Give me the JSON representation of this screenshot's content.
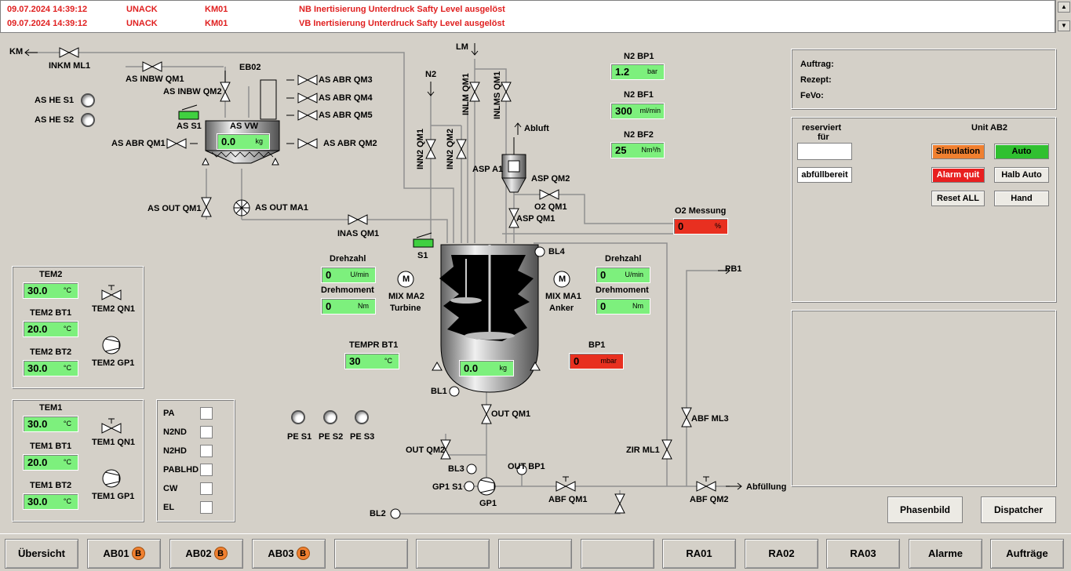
{
  "alarms": [
    {
      "time": "09.07.2024 14:39:12",
      "state": "UNACK",
      "module": "KM01",
      "text": "NB Inertisierung Unterdruck Safty Level ausgelöst"
    },
    {
      "time": "09.07.2024 14:39:12",
      "state": "UNACK",
      "module": "KM01",
      "text": "VB Inertisierung Unterdruck Safty Level ausgelöst"
    }
  ],
  "labels": {
    "km": "KM",
    "inkm_ml1": "INKM ML1",
    "as_inbw_qm1": "AS INBW QM1",
    "as_inbw_qm2": "AS INBW QM2",
    "eb02": "EB02",
    "as_abr_qm3": "AS ABR QM3",
    "as_abr_qm4": "AS ABR QM4",
    "as_abr_qm5": "AS ABR QM5",
    "as_he_s1": "AS HE S1",
    "as_he_s2": "AS HE S2",
    "as_s1": "AS S1",
    "as_vw": "AS VW",
    "as_abr_qm1": "AS ABR QM1",
    "as_abr_qm2": "AS ABR QM2",
    "as_out_qm1": "AS OUT QM1",
    "as_out_ma1": "AS OUT MA1",
    "inas_qm1": "INAS QM1",
    "lm": "LM",
    "n2": "N2",
    "inlm_qm1": "INLM QM1",
    "inlms_qm1": "INLMS QM1",
    "inn2_qm1": "INN2 QM1",
    "inn2_qm2": "INN2 QM2",
    "abluft": "Abluft",
    "asp_a1": "ASP A1",
    "asp_qm2": "ASP QM2",
    "o2_qm1": "O2 QM1",
    "asp_qm1": "ASP QM1",
    "n2_bp1": "N2 BP1",
    "n2_bf1": "N2 BF1",
    "n2_bf2": "N2 BF2",
    "o2_messung": "O2 Messung",
    "s1": "S1",
    "bl4": "BL4",
    "drehzahl_l": "Drehzahl",
    "drehmoment_l": "Drehmoment",
    "mix_ma2": "MIX MA2",
    "turbine": "Turbine",
    "drehzahl_r": "Drehzahl",
    "drehmoment_r": "Drehmoment",
    "mix_ma1": "MIX MA1",
    "anker": "Anker",
    "pb1": "PB1",
    "tempr_bt1": "TEMPR BT1",
    "bp1": "BP1",
    "bl1": "BL1",
    "out_qm1": "OUT QM1",
    "out_qm2": "OUT QM2",
    "bl3": "BL3",
    "out_bp1": "OUT BP1",
    "gp1_s1": "GP1 S1",
    "gp1": "GP1",
    "abf_qm1": "ABF QM1",
    "zir_ml1": "ZIR ML1",
    "abf_ml3": "ABF ML3",
    "abf_qm2": "ABF QM2",
    "abfuellung": "Abfüllung",
    "bl2": "BL2",
    "pe_s1": "PE S1",
    "pe_s2": "PE S2",
    "pe_s3": "PE S3",
    "m": "M"
  },
  "values": {
    "as_vw": {
      "value": "0.0",
      "unit": "kg"
    },
    "n2_bp1": {
      "value": "1.2",
      "unit": "bar"
    },
    "n2_bf1": {
      "value": "300",
      "unit": "ml/min"
    },
    "n2_bf2": {
      "value": "25",
      "unit": "Nm³/h"
    },
    "o2": {
      "value": "0",
      "unit": "%"
    },
    "drehzahl_l": {
      "value": "0",
      "unit": "U/min"
    },
    "drehmoment_l": {
      "value": "0",
      "unit": "Nm"
    },
    "drehzahl_r": {
      "value": "0",
      "unit": "U/min"
    },
    "drehmoment_r": {
      "value": "0",
      "unit": "Nm"
    },
    "tempr_bt1": {
      "value": "30",
      "unit": "°C"
    },
    "bp1": {
      "value": "0",
      "unit": "mbar"
    },
    "reactor": {
      "value": "0.0",
      "unit": "kg"
    }
  },
  "tem2": {
    "title": "TEM2",
    "value": "30.0",
    "unit": "°C",
    "bt1_label": "TEM2 BT1",
    "bt1_value": "20.0",
    "bt1_unit": "°C",
    "bt2_label": "TEM2 BT2",
    "bt2_value": "30.0",
    "bt2_unit": "°C",
    "qn1": "TEM2 QN1",
    "gp1": "TEM2 GP1"
  },
  "tem1": {
    "title": "TEM1",
    "value": "30.0",
    "unit": "°C",
    "bt1_label": "TEM1 BT1",
    "bt1_value": "20.0",
    "bt1_unit": "°C",
    "bt2_label": "TEM1 BT2",
    "bt2_value": "30.0",
    "bt2_unit": "°C",
    "qn1": "TEM1 QN1",
    "gp1": "TEM1 GP1"
  },
  "checks": [
    "PA",
    "N2ND",
    "N2HD",
    "PABLHD",
    "CW",
    "EL"
  ],
  "info": {
    "auftrag": "Auftrag:",
    "rezept": "Rezept:",
    "fevo": "FeVo:"
  },
  "unit": {
    "reserviert": "reserviert",
    "fuer": "für",
    "title": "Unit AB2",
    "abfuellbereit": "abfüllbereit",
    "simulation": "Simulation",
    "auto": "Auto",
    "alarm_quit": "Alarm quit",
    "halb_auto": "Halb Auto",
    "reset_all": "Reset ALL",
    "hand": "Hand"
  },
  "actions": {
    "phasenbild": "Phasenbild",
    "dispatcher": "Dispatcher"
  },
  "nav": [
    {
      "label": "Übersicht",
      "badge": ""
    },
    {
      "label": "AB01",
      "badge": "B"
    },
    {
      "label": "AB02",
      "badge": "B"
    },
    {
      "label": "AB03",
      "badge": "B"
    },
    {
      "label": "",
      "badge": ""
    },
    {
      "label": "",
      "badge": ""
    },
    {
      "label": "",
      "badge": ""
    },
    {
      "label": "",
      "badge": ""
    },
    {
      "label": "RA01",
      "badge": ""
    },
    {
      "label": "RA02",
      "badge": ""
    },
    {
      "label": "RA03",
      "badge": ""
    },
    {
      "label": "Alarme",
      "badge": ""
    },
    {
      "label": "Aufträge",
      "badge": ""
    }
  ],
  "colors": {
    "value_green": "#7df07d",
    "alarm_red": "#e83020",
    "accent_orange": "#f08030",
    "auto_green": "#30c030"
  }
}
